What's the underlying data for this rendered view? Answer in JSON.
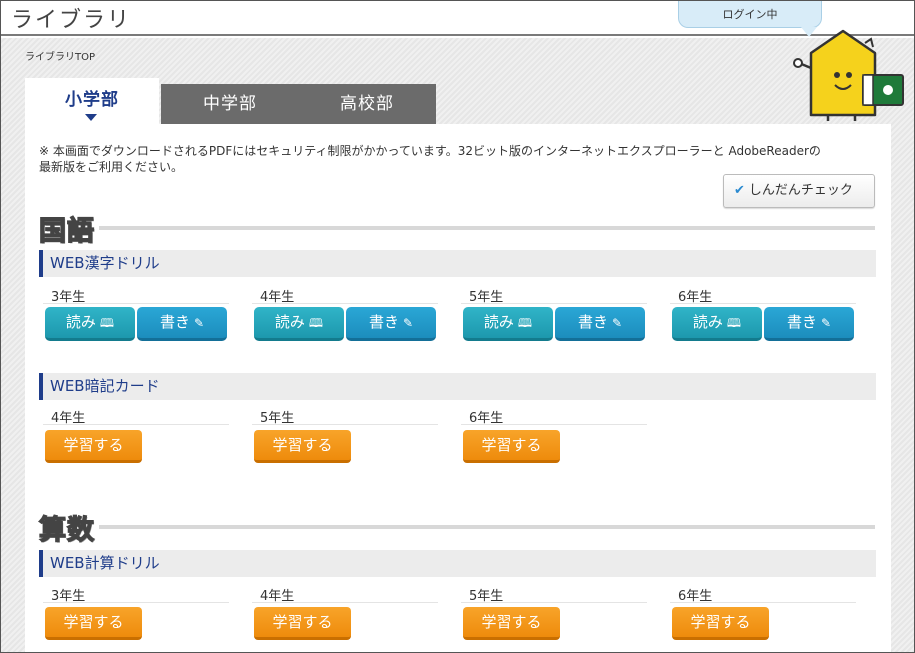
{
  "header": {
    "title": "ライブラリ",
    "login_status": "ログイン中"
  },
  "breadcrumb": "ライブラリTOP",
  "tabs": [
    {
      "label": "小学部",
      "active": true
    },
    {
      "label": "中学部",
      "active": false
    },
    {
      "label": "高校部",
      "active": false
    }
  ],
  "notice": "※ 本画面でダウンロードされるPDFにはセキュリティ制限がかかっています。32ビット版のインターネットエクスプローラーと AdobeReaderの 最新版をご利用ください。",
  "check_button": "しんだんチェック",
  "subjects": [
    {
      "name": "国語",
      "sections": [
        {
          "title": "WEB漢字ドリル",
          "grades": [
            "3年生",
            "4年生",
            "5年生",
            "6年生"
          ],
          "read_label": "読み",
          "write_label": "書き"
        },
        {
          "title": "WEB暗記カード",
          "grades": [
            "4年生",
            "5年生",
            "6年生"
          ],
          "study_label": "学習する"
        }
      ]
    },
    {
      "name": "算数",
      "sections": [
        {
          "title": "WEB計算ドリル",
          "grades": [
            "3年生",
            "4年生",
            "5年生",
            "6年生"
          ],
          "study_label": "学習する"
        }
      ]
    }
  ],
  "colors": {
    "accent_navy": "#1f3d8a",
    "teal": "#1d98ad",
    "orange": "#ee8b0c",
    "tab_inactive": "#6b6b6b"
  },
  "icons": {
    "read": "book-icon",
    "write": "pencil-icon",
    "check": "checkmark-icon"
  }
}
